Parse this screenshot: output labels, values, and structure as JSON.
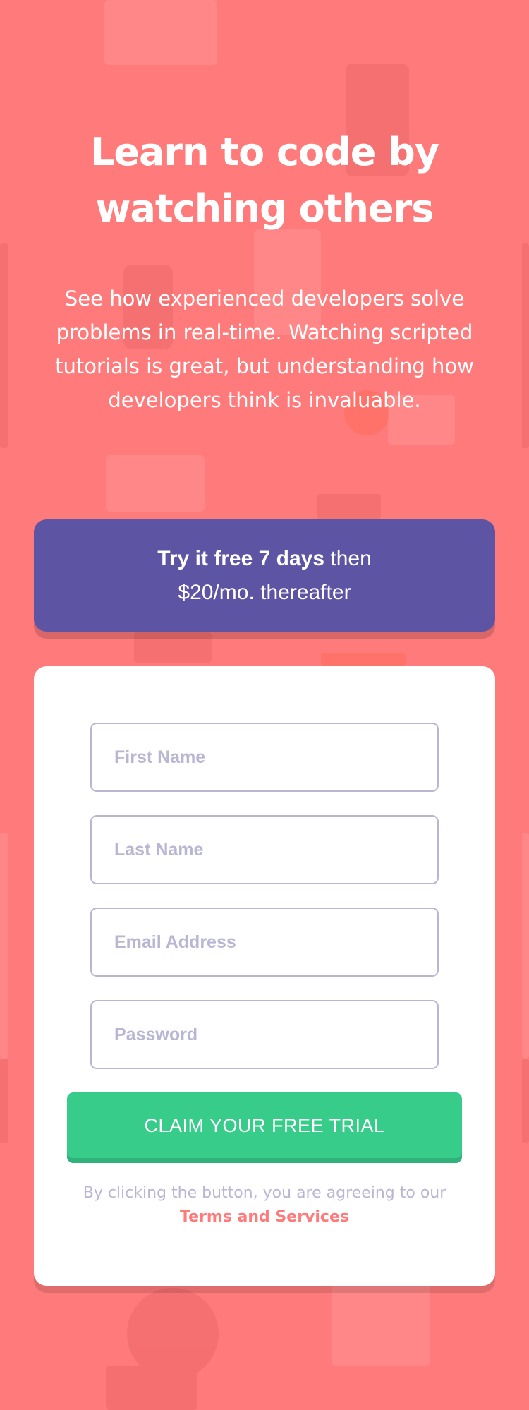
{
  "hero": {
    "title_line1": "Learn to code by",
    "title_line2": "watching others",
    "description": "See how experienced developers solve problems in real-time. Watching scripted tutorials is great, but understanding how developers think is invaluable."
  },
  "trial_banner": {
    "bold_text": "Try it free 7 days",
    "rest_text": " then",
    "second_line": "$20/mo. thereafter"
  },
  "form": {
    "fields": [
      {
        "name": "first-name",
        "placeholder": "First Name",
        "value": ""
      },
      {
        "name": "last-name",
        "placeholder": "Last Name",
        "value": ""
      },
      {
        "name": "email",
        "placeholder": "Email Address",
        "value": ""
      },
      {
        "name": "password",
        "placeholder": "Password",
        "value": ""
      }
    ],
    "submit_label": "CLAIM YOUR FREE TRIAL",
    "terms_prefix": "By clicking the button, you are agreeing to our ",
    "terms_link": "Terms and Services"
  },
  "colors": {
    "background": "#ff7a7a",
    "banner": "#5e54a4",
    "button": "#38cc8b",
    "placeholder": "#b9b6d3",
    "link": "#ff7a7a"
  }
}
